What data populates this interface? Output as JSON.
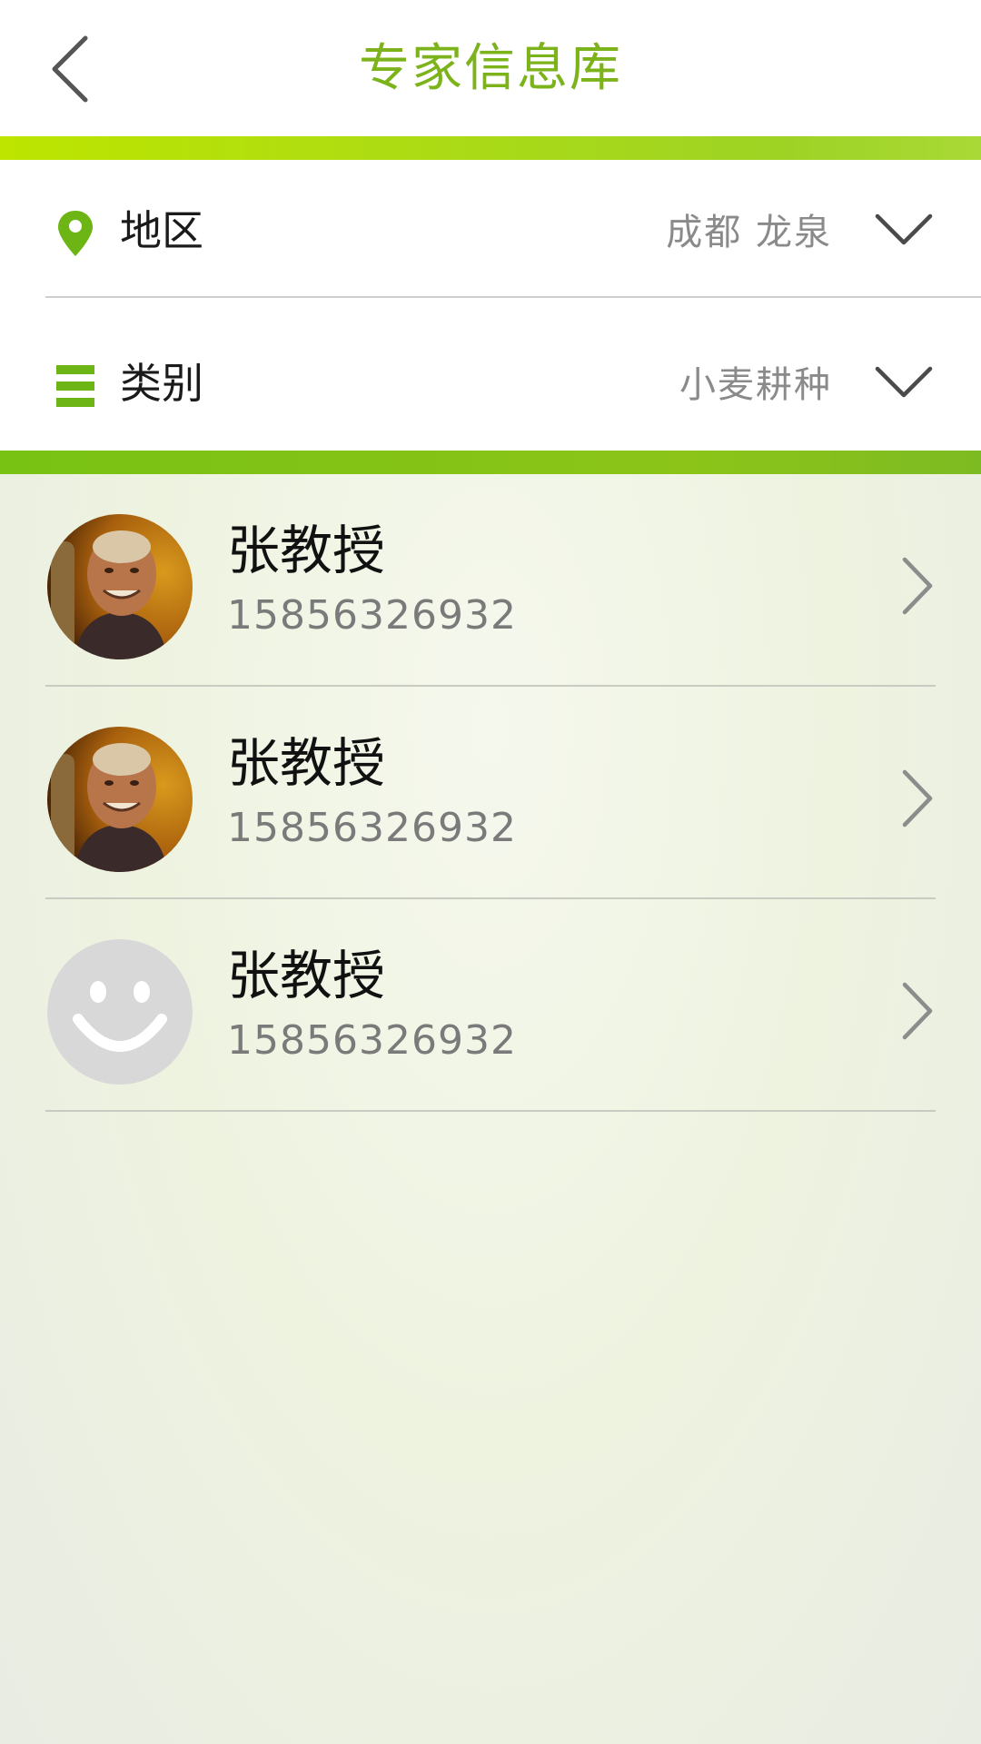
{
  "header": {
    "title": "专家信息库",
    "back_icon": "chevron-left-icon"
  },
  "filters": [
    {
      "label": "地区",
      "value": "成都 龙泉",
      "icon": "location-pin-icon"
    },
    {
      "label": "类别",
      "value": "小麦耕种",
      "icon": "list-icon"
    }
  ],
  "experts": [
    {
      "name": "张教授",
      "phone": "15856326932",
      "avatar": "photo"
    },
    {
      "name": "张教授",
      "phone": "15856326932",
      "avatar": "photo"
    },
    {
      "name": "张教授",
      "phone": "15856326932",
      "avatar": "default-smiley"
    }
  ],
  "colors": {
    "accent": "#7cb31a",
    "bar_top": "#bde500",
    "bar_bottom": "#78c214"
  }
}
